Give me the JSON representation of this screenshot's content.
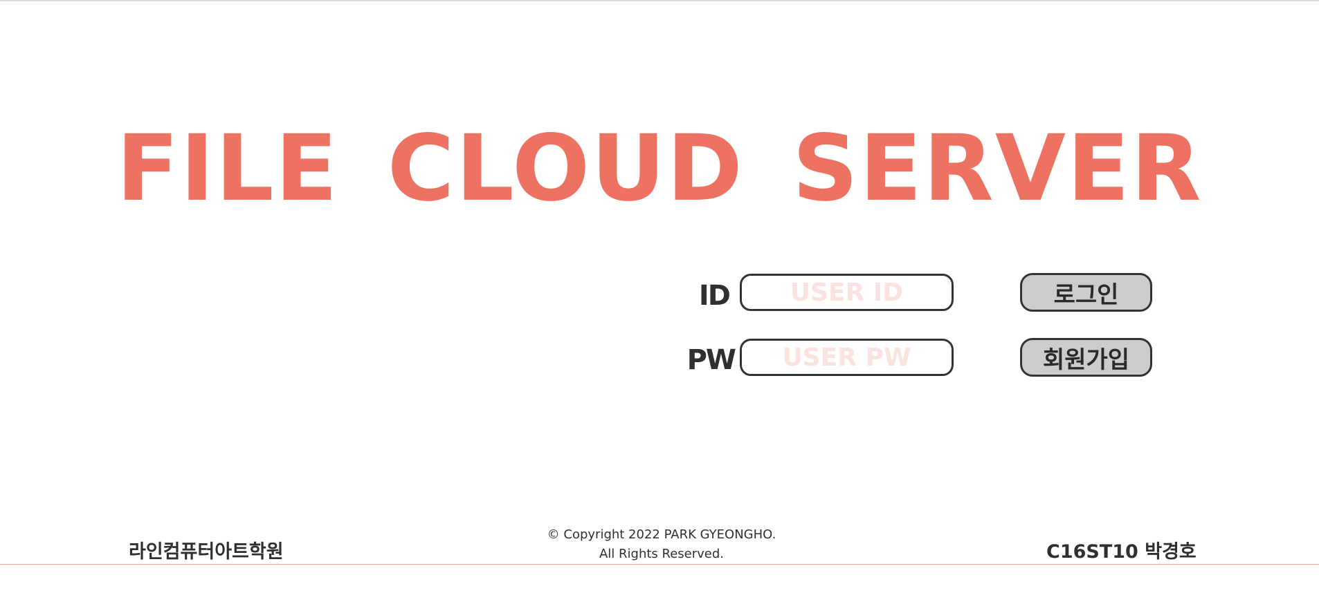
{
  "header": {
    "title": "FILE CLOUD SERVER"
  },
  "login_form": {
    "id_label": "ID",
    "id_placeholder": "USER ID",
    "pw_label": "PW",
    "pw_placeholder": "USER PW",
    "login_button": "로그인",
    "signup_button": "회원가입"
  },
  "footer": {
    "academy": "라인컴퓨터아트학원",
    "copyright_line1": "© Copyright 2022 PARK GYEONGHO.",
    "copyright_line2": "All Rights Reserved.",
    "author": "C16ST10 박경호"
  },
  "colors": {
    "accent": "#ee7261",
    "placeholder": "#fbe2de",
    "button_bg": "#cccccc",
    "text_dark": "#2f2f2f"
  }
}
